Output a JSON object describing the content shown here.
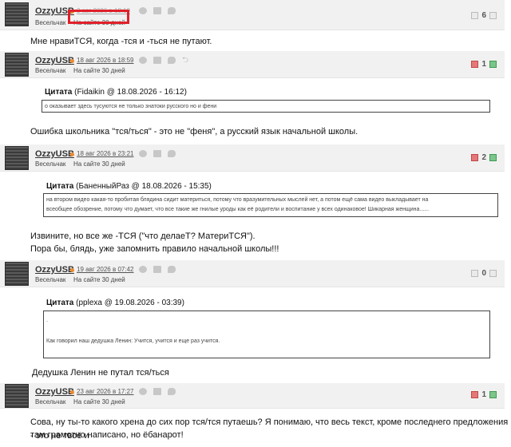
{
  "rank_label": "Весельчак",
  "site_days": "На сайте 30 дней",
  "posts": [
    {
      "username": "OzzyUSB",
      "date": "2 авг 2026 в 18:19",
      "votes": "6",
      "text": [
        "Мне нравиТСЯ, когда -тся и -ться не путают."
      ]
    },
    {
      "username": "OzzyUSB",
      "date": "18 авг 2026 в 18:59",
      "votes": "1",
      "quote_label": "Цитата",
      "quote_author": "(Fidaikin @ 18.08.2026 - 16:12)",
      "quote_lines": [
        "о оказывает здесь тусуются не только знатоки русского но и фени"
      ],
      "text": [
        "Ошибка школьника \"тся/ться\" - это не \"феня\", а русский язык начальной школы."
      ]
    },
    {
      "username": "OzzyUSB",
      "date": "18 авг 2026 в 23:21",
      "votes": "2",
      "quote_label": "Цитата",
      "quote_author": "(БаненныйРаз @ 18.08.2026 - 15:35)",
      "quote_lines": [
        "на втором видео какая-то пробитая блядина сидит материться, потому что вразумительных мыслей нет, а потом ещё сама видео выкладывает на",
        "всеобщее обозрение, потому что думает, что все такие же гнилые уроды как её родители и воспитание у всех одинаковое! Шикарная женщина......"
      ],
      "text": [
        "Извините, но все же -ТСЯ (\"что делаеТ? МатериТСЯ\").",
        "Пора бы, блядь, уже запомнить правило начальной школы!!!"
      ]
    },
    {
      "username": "OzzyUSB",
      "date": "19 авг 2026 в 07:42",
      "votes": "0",
      "quote_label": "Цитата",
      "quote_author": "(pplexa @ 19.08.2026 - 03:39)",
      "quote_lines": [
        ".",
        "",
        "Как говорил наш дедушка Ленин: Учится, учится и еще раз учится."
      ],
      "text": [
        "Дедушка Ленин не путал тся/ться"
      ]
    },
    {
      "username": "OzzyUSB",
      "date": "23 авг 2026 в 17:27",
      "votes": "1",
      "text": [
        "Сова, ну ты-то какого хрена до сих пор тся/тся путаешь? Я понимаю, что весь текст, кроме последнего предложения - это не твоё и",
        "там грамотно написано, но ёбанарот!"
      ]
    }
  ]
}
